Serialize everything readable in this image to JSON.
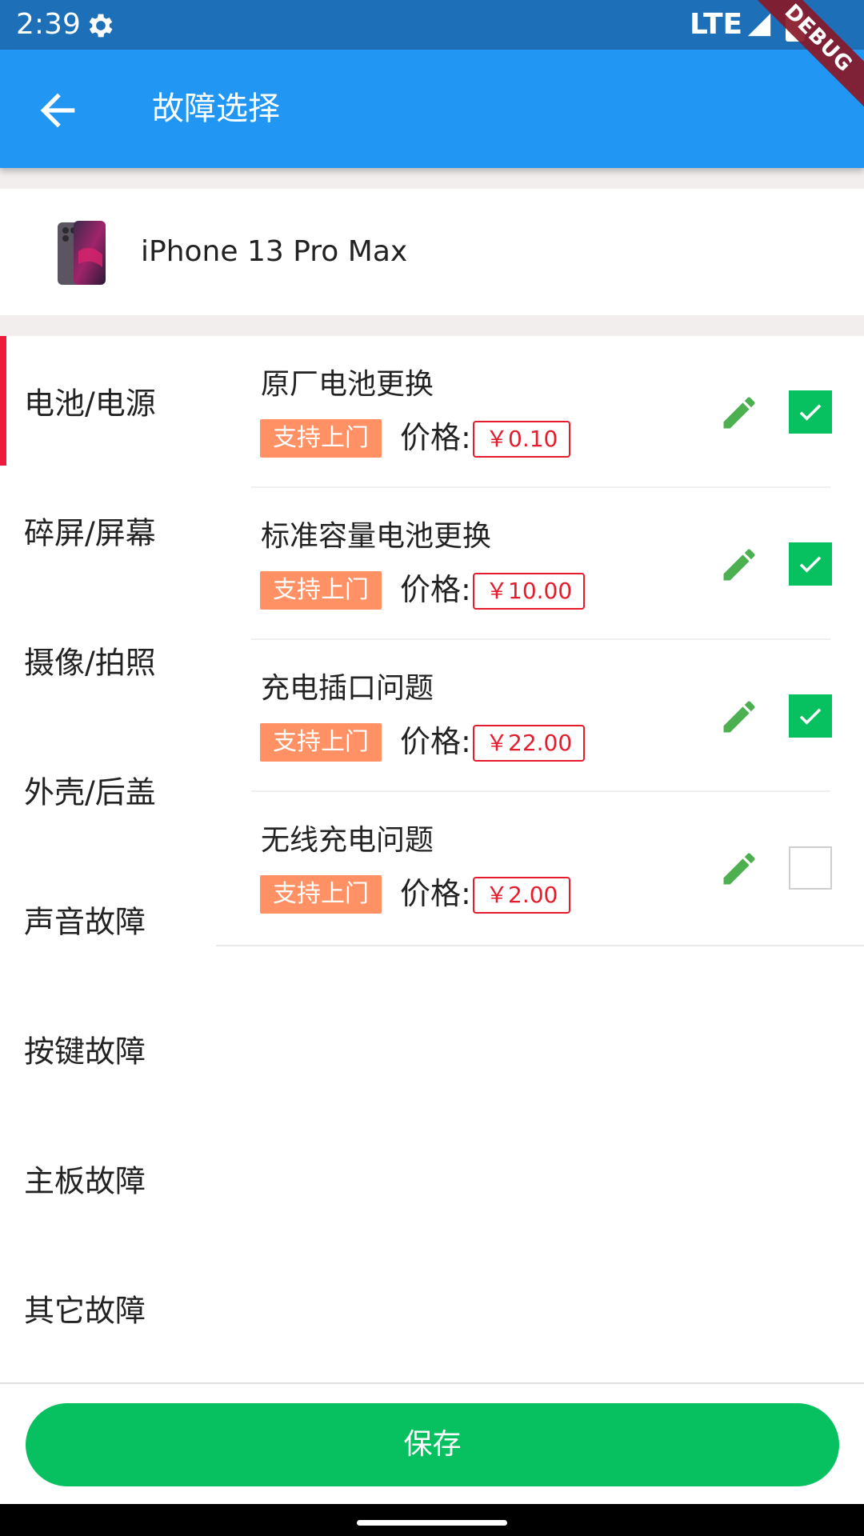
{
  "status_bar": {
    "time": "2:39",
    "network": "LTE",
    "debug_label": "DEBUG"
  },
  "app_bar": {
    "title": "故障选择"
  },
  "device": {
    "name": "iPhone 13 Pro Max"
  },
  "categories": [
    {
      "label": "电池/电源",
      "active": true
    },
    {
      "label": "碎屏/屏幕",
      "active": false
    },
    {
      "label": "摄像/拍照",
      "active": false
    },
    {
      "label": "外壳/后盖",
      "active": false
    },
    {
      "label": "声音故障",
      "active": false
    },
    {
      "label": "按键故障",
      "active": false
    },
    {
      "label": "主板故障",
      "active": false
    },
    {
      "label": "其它故障",
      "active": false
    }
  ],
  "faults": [
    {
      "title": "原厂电池更换",
      "tag": "支持上门",
      "price_label": "价格:",
      "price": "￥0.10",
      "checked": true
    },
    {
      "title": "标准容量电池更换",
      "tag": "支持上门",
      "price_label": "价格:",
      "price": "￥10.00",
      "checked": true
    },
    {
      "title": "充电插口问题",
      "tag": "支持上门",
      "price_label": "价格:",
      "price": "￥22.00",
      "checked": true
    },
    {
      "title": "无线充电问题",
      "tag": "支持上门",
      "price_label": "价格:",
      "price": "￥2.00",
      "checked": false
    }
  ],
  "actions": {
    "save_label": "保存"
  },
  "colors": {
    "status_bar": "#1d6fb8",
    "app_bar": "#2196f3",
    "accent_green": "#07c160",
    "active_indicator": "#ee1c3c",
    "tag_orange": "#ff9165",
    "price_red": "#e51c2c",
    "edit_icon_green": "#4caf50"
  },
  "icons": {
    "back": "arrow-left-icon",
    "settings": "gear-icon",
    "signal": "signal-icon",
    "battery": "battery-icon",
    "edit": "pencil-icon",
    "check": "checkmark-icon"
  }
}
